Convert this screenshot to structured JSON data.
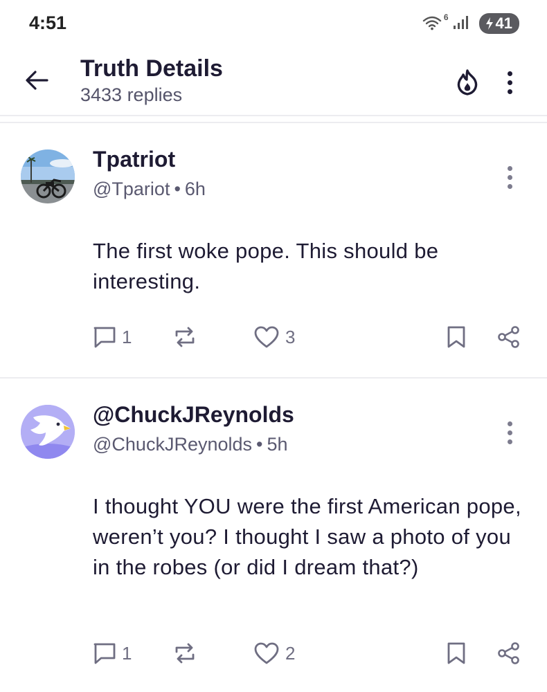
{
  "status_bar": {
    "time": "4:51",
    "wifi_badge": "6",
    "battery": "41"
  },
  "header": {
    "title": "Truth Details",
    "subtitle": "3433 replies"
  },
  "posts": [
    {
      "display_name": "Tpatriot",
      "handle": "@Tpariot",
      "separator": "•",
      "time": "6h",
      "text": "The first woke pope. This should be interesting.",
      "reply_count": "1",
      "like_count": "3",
      "avatar": "bicycle-photo-avatar"
    },
    {
      "display_name": "@ChuckJReynolds",
      "handle": "@ChuckJReynolds",
      "separator": "•",
      "time": "5h",
      "text": "I thought YOU were the first American pope, weren’t you? I thought I saw a photo of you in the robes (or did I dream that?)",
      "reply_count": "1",
      "like_count": "2",
      "avatar": "eagle-default-avatar"
    }
  ],
  "icons": {
    "back": "arrow-left-icon",
    "trending": "flame-icon",
    "menu": "kebab-menu-icon",
    "reply": "comment-icon",
    "retruth": "repost-icon",
    "like": "heart-icon",
    "bookmark": "bookmark-icon",
    "share": "share-icon"
  },
  "colors": {
    "text_primary": "#1e1b33",
    "text_secondary": "#5a5970",
    "icon_gray": "#6f6e82",
    "avatar_purple": "#a9a3f3"
  }
}
